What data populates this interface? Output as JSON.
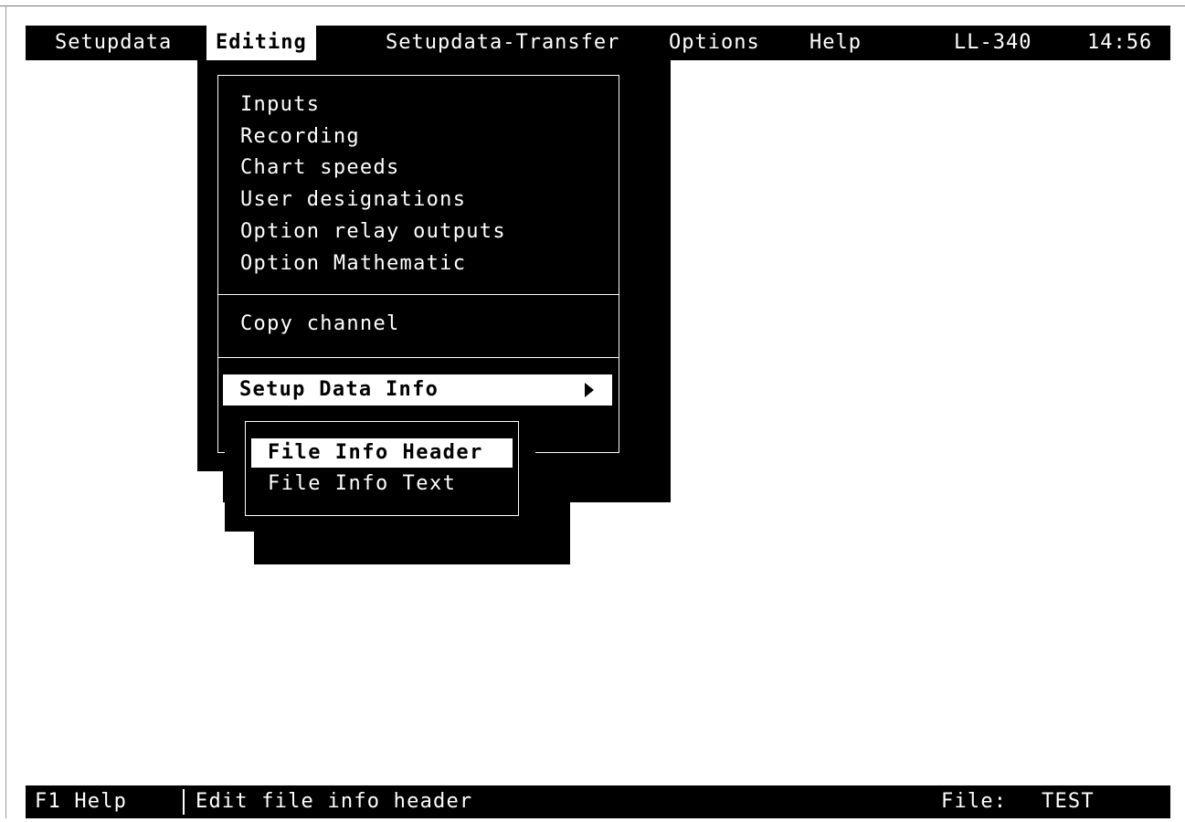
{
  "menubar": {
    "items": [
      {
        "label": "Setupdata"
      },
      {
        "label": "Editing"
      },
      {
        "label": "Setupdata-Transfer"
      },
      {
        "label": "Options"
      },
      {
        "label": "Help"
      }
    ],
    "device": "LL-340",
    "clock": "14:56"
  },
  "editing_menu": {
    "items": [
      {
        "label": "Inputs"
      },
      {
        "label": "Recording"
      },
      {
        "label": "Chart speeds"
      },
      {
        "label": "User designations"
      },
      {
        "label": "Option relay outputs"
      },
      {
        "label": "Option Mathematic"
      }
    ],
    "copy_channel": "Copy channel",
    "setup_data_info": "Setup Data Info"
  },
  "submenu": {
    "items": [
      {
        "label": "File Info Header"
      },
      {
        "label": "File Info Text"
      }
    ]
  },
  "statusbar": {
    "help": "F1 Help",
    "message": "Edit file info header",
    "file_label": "File:",
    "file_name": "TEST"
  }
}
